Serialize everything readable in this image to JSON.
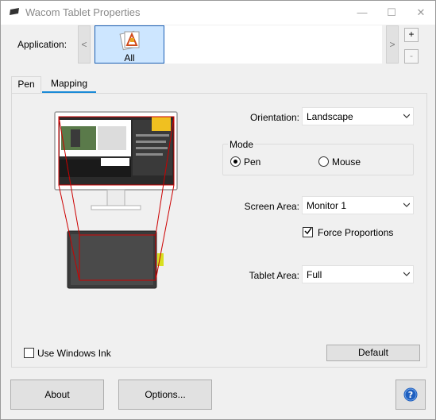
{
  "window": {
    "title": "Wacom Tablet Properties",
    "minimize_glyph": "—",
    "maximize_glyph": "☐",
    "close_glyph": "✕"
  },
  "application": {
    "label": "Application:",
    "scroll_left": "<",
    "scroll_right": ">",
    "items": [
      {
        "label": "All",
        "icon": "all-apps-icon",
        "selected": true
      }
    ],
    "add": "+",
    "remove": "-"
  },
  "tabs": [
    {
      "label": "Pen",
      "active": false
    },
    {
      "label": "Mapping",
      "active": true
    }
  ],
  "mapping": {
    "orientation": {
      "label": "Orientation:",
      "value": "Landscape"
    },
    "mode": {
      "title": "Mode",
      "options": [
        {
          "label": "Pen",
          "selected": true
        },
        {
          "label": "Mouse",
          "selected": false
        }
      ]
    },
    "screen_area": {
      "label": "Screen Area:",
      "value": "Monitor 1"
    },
    "force_proportions": {
      "label": "Force Proportions",
      "checked": true
    },
    "tablet_area": {
      "label": "Tablet Area:",
      "value": "Full"
    },
    "use_windows_ink": {
      "label": "Use Windows Ink",
      "checked": false
    },
    "default_button": "Default"
  },
  "footer": {
    "about": "About",
    "options": "Options...",
    "help_icon": "help-icon"
  },
  "colors": {
    "accent": "#1a8ad6",
    "selected_tile": "#cde6ff",
    "mapping_lines": "#cc0000",
    "help_icon": "#1f5fbf"
  }
}
